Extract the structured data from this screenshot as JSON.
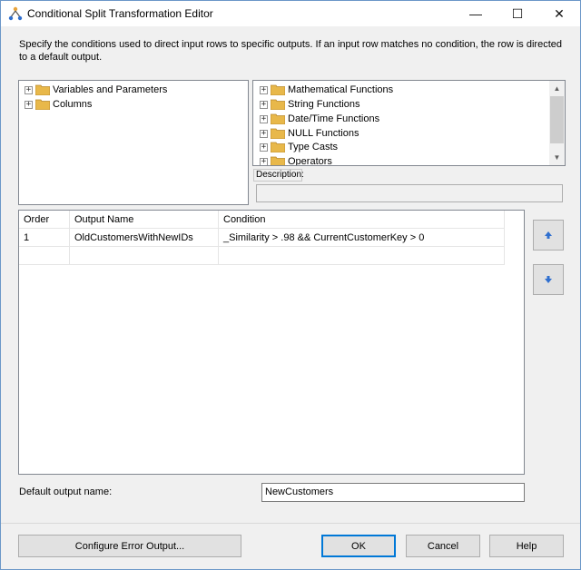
{
  "window": {
    "title": "Conditional Split Transformation Editor",
    "minimize": "—",
    "maximize": "☐",
    "close": "✕"
  },
  "instructions": "Specify the conditions used to direct input rows to specific outputs. If an input row matches no condition, the row is directed to a default output.",
  "left_tree": {
    "items": [
      {
        "label": "Variables and Parameters",
        "expander": "+"
      },
      {
        "label": "Columns",
        "expander": "+"
      }
    ]
  },
  "right_tree": {
    "items": [
      {
        "label": "Mathematical Functions",
        "expander": "+"
      },
      {
        "label": "String Functions",
        "expander": "+"
      },
      {
        "label": "Date/Time Functions",
        "expander": "+"
      },
      {
        "label": "NULL Functions",
        "expander": "+"
      },
      {
        "label": "Type Casts",
        "expander": "+"
      },
      {
        "label": "Operators",
        "expander": "+"
      }
    ],
    "scroll_up": "▲",
    "scroll_down": "▼"
  },
  "description": {
    "label": "Description:",
    "value": ""
  },
  "grid": {
    "columns": [
      "Order",
      "Output Name",
      "Condition"
    ],
    "rows": [
      {
        "order": "1",
        "output_name": "OldCustomersWithNewIDs",
        "condition": "_Similarity > .98 && CurrentCustomerKey > 0"
      }
    ]
  },
  "default_output": {
    "label": "Default output name:",
    "value": "NewCustomers"
  },
  "buttons": {
    "configure_error": "Configure Error Output...",
    "ok": "OK",
    "cancel": "Cancel",
    "help": "Help"
  },
  "colors": {
    "folder": "#e8b84a",
    "arrow_blue": "#2f6fcf",
    "accent": "#0078d7"
  }
}
